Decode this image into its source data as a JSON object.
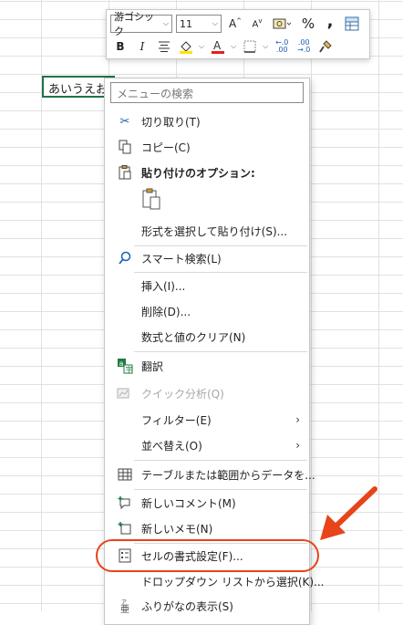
{
  "cell": {
    "value": "あいうえお"
  },
  "mini_toolbar": {
    "font_name": "游ゴシック",
    "font_size": "11",
    "bold": "B",
    "italic": "I",
    "percent": "%",
    "comma": ","
  },
  "menu": {
    "search_placeholder": "メニューの検索",
    "items": [
      {
        "label": "切り取り(T)"
      },
      {
        "label": "コピー(C)"
      },
      {
        "label": "貼り付けのオプション:"
      },
      {
        "label": "形式を選択して貼り付け(S)..."
      },
      {
        "label": "スマート検索(L)"
      },
      {
        "label": "挿入(I)..."
      },
      {
        "label": "削除(D)..."
      },
      {
        "label": "数式と値のクリア(N)"
      },
      {
        "label": "翻訳"
      },
      {
        "label": "クイック分析(Q)"
      },
      {
        "label": "フィルター(E)"
      },
      {
        "label": "並べ替え(O)"
      },
      {
        "label": "テーブルまたは範囲からデータを..."
      },
      {
        "label": "新しいコメント(M)"
      },
      {
        "label": "新しいメモ(N)"
      },
      {
        "label": "セルの書式設定(F)..."
      },
      {
        "label": "ドロップダウン リストから選択(K)..."
      },
      {
        "label": "ふりがなの表示(S)"
      }
    ]
  },
  "colors": {
    "accent": "#217346",
    "highlight": "#e8431a",
    "arrow": "#e8431a"
  }
}
